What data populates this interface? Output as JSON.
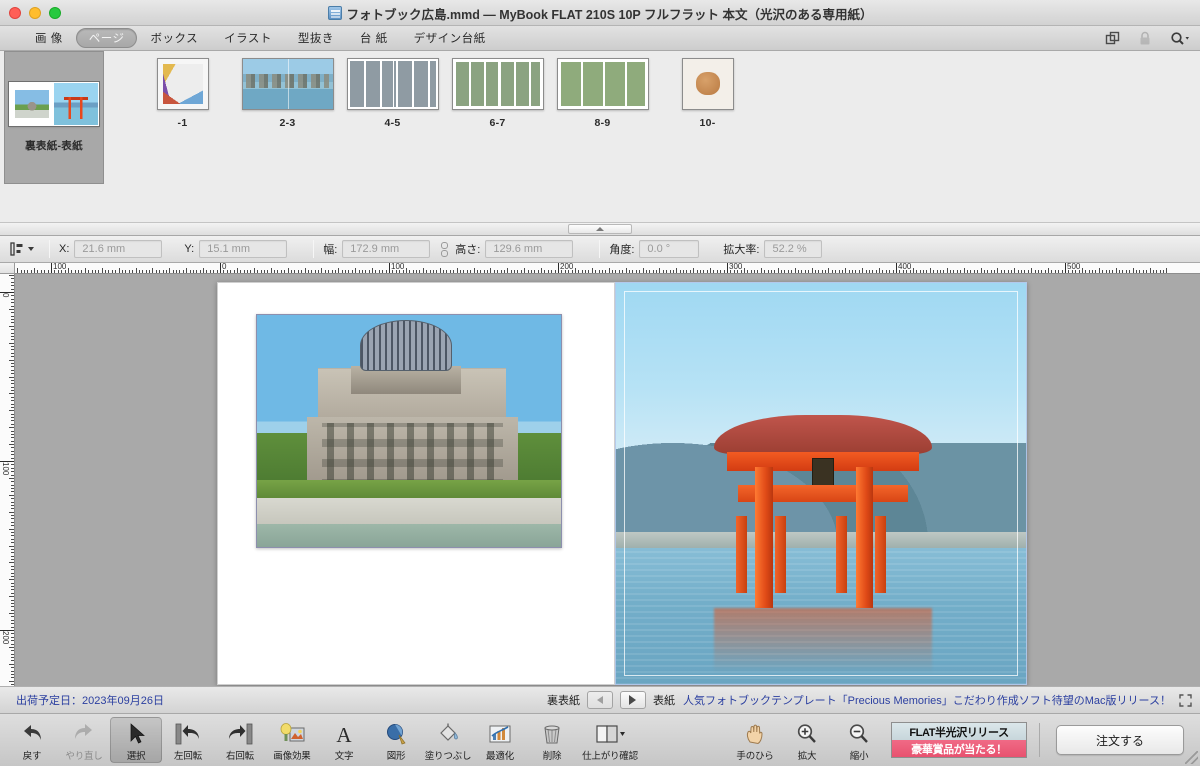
{
  "window": {
    "title": "フォトブック広島.mmd — MyBook FLAT 210S 10P フルフラット 本文（光沢のある専用紙）",
    "doc_icon": "document-icon",
    "traffic_lights": [
      "close",
      "minimize",
      "zoom"
    ]
  },
  "tabbar": {
    "tabs": [
      {
        "label": "画 像",
        "name": "tab-images",
        "active": false
      },
      {
        "label": "ページ",
        "name": "tab-pages",
        "active": true
      },
      {
        "label": "ボックス",
        "name": "tab-boxes",
        "active": false
      },
      {
        "label": "イラスト",
        "name": "tab-illustrations",
        "active": false
      },
      {
        "label": "型抜き",
        "name": "tab-diecut",
        "active": false
      },
      {
        "label": "台 紙",
        "name": "tab-mount",
        "active": false
      },
      {
        "label": "デザイン台紙",
        "name": "tab-design-mount",
        "active": false
      }
    ],
    "right_icons": [
      "duplicate-icon",
      "lock-icon",
      "search-icon"
    ]
  },
  "thumbnails": [
    {
      "label": "裏表紙-表紙",
      "selected": true,
      "kind": "cover"
    },
    {
      "label": "-1",
      "selected": false,
      "kind": "single-collage"
    },
    {
      "label": "2-3",
      "selected": false,
      "kind": "spread-photo"
    },
    {
      "label": "4-5",
      "selected": false,
      "kind": "spread-grid"
    },
    {
      "label": "6-7",
      "selected": false,
      "kind": "spread-grid2"
    },
    {
      "label": "8-9",
      "selected": false,
      "kind": "spread-grid3"
    },
    {
      "label": "10-",
      "selected": false,
      "kind": "single-food"
    }
  ],
  "propbar": {
    "align_icon": "align-objects-icon",
    "fields": [
      {
        "label": "X:",
        "value": "21.6 mm",
        "name": "x-position-field"
      },
      {
        "label": "Y:",
        "value": "15.1 mm",
        "name": "y-position-field"
      },
      {
        "label": "幅:",
        "value": "172.9 mm",
        "name": "width-field"
      },
      {
        "label": "高さ:",
        "value": "129.6 mm",
        "name": "height-field"
      },
      {
        "label": "角度:",
        "value": "0.0 °",
        "name": "angle-field"
      },
      {
        "label": "拡大率:",
        "value": "52.2 %",
        "name": "scale-field"
      }
    ],
    "link_icon": "link-chain-icon"
  },
  "rulers": {
    "horizontal_labels": [
      "100",
      "0",
      "100",
      "200",
      "300",
      "400",
      "500"
    ],
    "vertical_labels": [
      "0",
      "100",
      "200"
    ],
    "unit": "mm"
  },
  "canvas": {
    "left_page_name": "裏表紙",
    "right_page_name": "表紙",
    "left_photo": "hiroshima-atomic-bomb-dome-photo",
    "right_photo": "itsukushima-torii-gate-photo"
  },
  "statusbar": {
    "ship_label": "出荷予定日：2023年09月26日",
    "back_page_label": "裏表紙",
    "front_page_label": "表紙",
    "prev_icon": "triangle-left-icon",
    "next_icon": "triangle-right-icon",
    "marquee": "人気フォトブックテンプレート「Precious Memories」こだわり作成ソフト待望のMac版リリース！",
    "expand_icon": "expand-icon"
  },
  "bottom_toolbar": {
    "tools": [
      {
        "label": "戻す",
        "icon": "undo-arrow-icon",
        "name": "undo-button",
        "state": "enabled"
      },
      {
        "label": "やり直し",
        "icon": "redo-arrow-icon",
        "name": "redo-button",
        "state": "disabled"
      },
      {
        "label": "選択",
        "icon": "cursor-arrow-icon",
        "name": "select-tool-button",
        "state": "selected"
      },
      {
        "label": "左回転",
        "icon": "rotate-left-icon",
        "name": "rotate-left-button",
        "state": "enabled"
      },
      {
        "label": "右回転",
        "icon": "rotate-right-icon",
        "name": "rotate-right-button",
        "state": "enabled"
      },
      {
        "label": "画像効果",
        "icon": "image-effects-icon",
        "name": "image-effects-button",
        "state": "enabled"
      },
      {
        "label": "文字",
        "icon": "text-a-icon",
        "name": "text-tool-button",
        "state": "enabled"
      },
      {
        "label": "図形",
        "icon": "shape-icon",
        "name": "shape-tool-button",
        "state": "enabled"
      },
      {
        "label": "塗りつぶし",
        "icon": "paint-bucket-icon",
        "name": "fill-tool-button",
        "state": "enabled"
      },
      {
        "label": "最適化",
        "icon": "optimize-chart-icon",
        "name": "optimize-button",
        "state": "enabled"
      },
      {
        "label": "削除",
        "icon": "trash-icon",
        "name": "delete-button",
        "state": "enabled"
      },
      {
        "label": "仕上がり確認",
        "icon": "open-book-icon",
        "name": "preview-button",
        "state": "enabled"
      }
    ],
    "view_tools": [
      {
        "label": "手のひら",
        "icon": "hand-icon",
        "name": "pan-tool-button"
      },
      {
        "label": "拡大",
        "icon": "zoom-in-icon",
        "name": "zoom-in-button"
      },
      {
        "label": "縮小",
        "icon": "zoom-out-icon",
        "name": "zoom-out-button"
      }
    ],
    "promo": {
      "line1": "FLAT半光沢リリース",
      "line2": "豪華賞品が当たる！",
      "line1_color": "#111111",
      "line2_bg": "#ea5470"
    },
    "order_button": "注文する"
  },
  "colors": {
    "link_blue": "#2b3fa0",
    "selection_gray": "#a8a8a8",
    "canvas_bg": "#a9a9a9"
  }
}
